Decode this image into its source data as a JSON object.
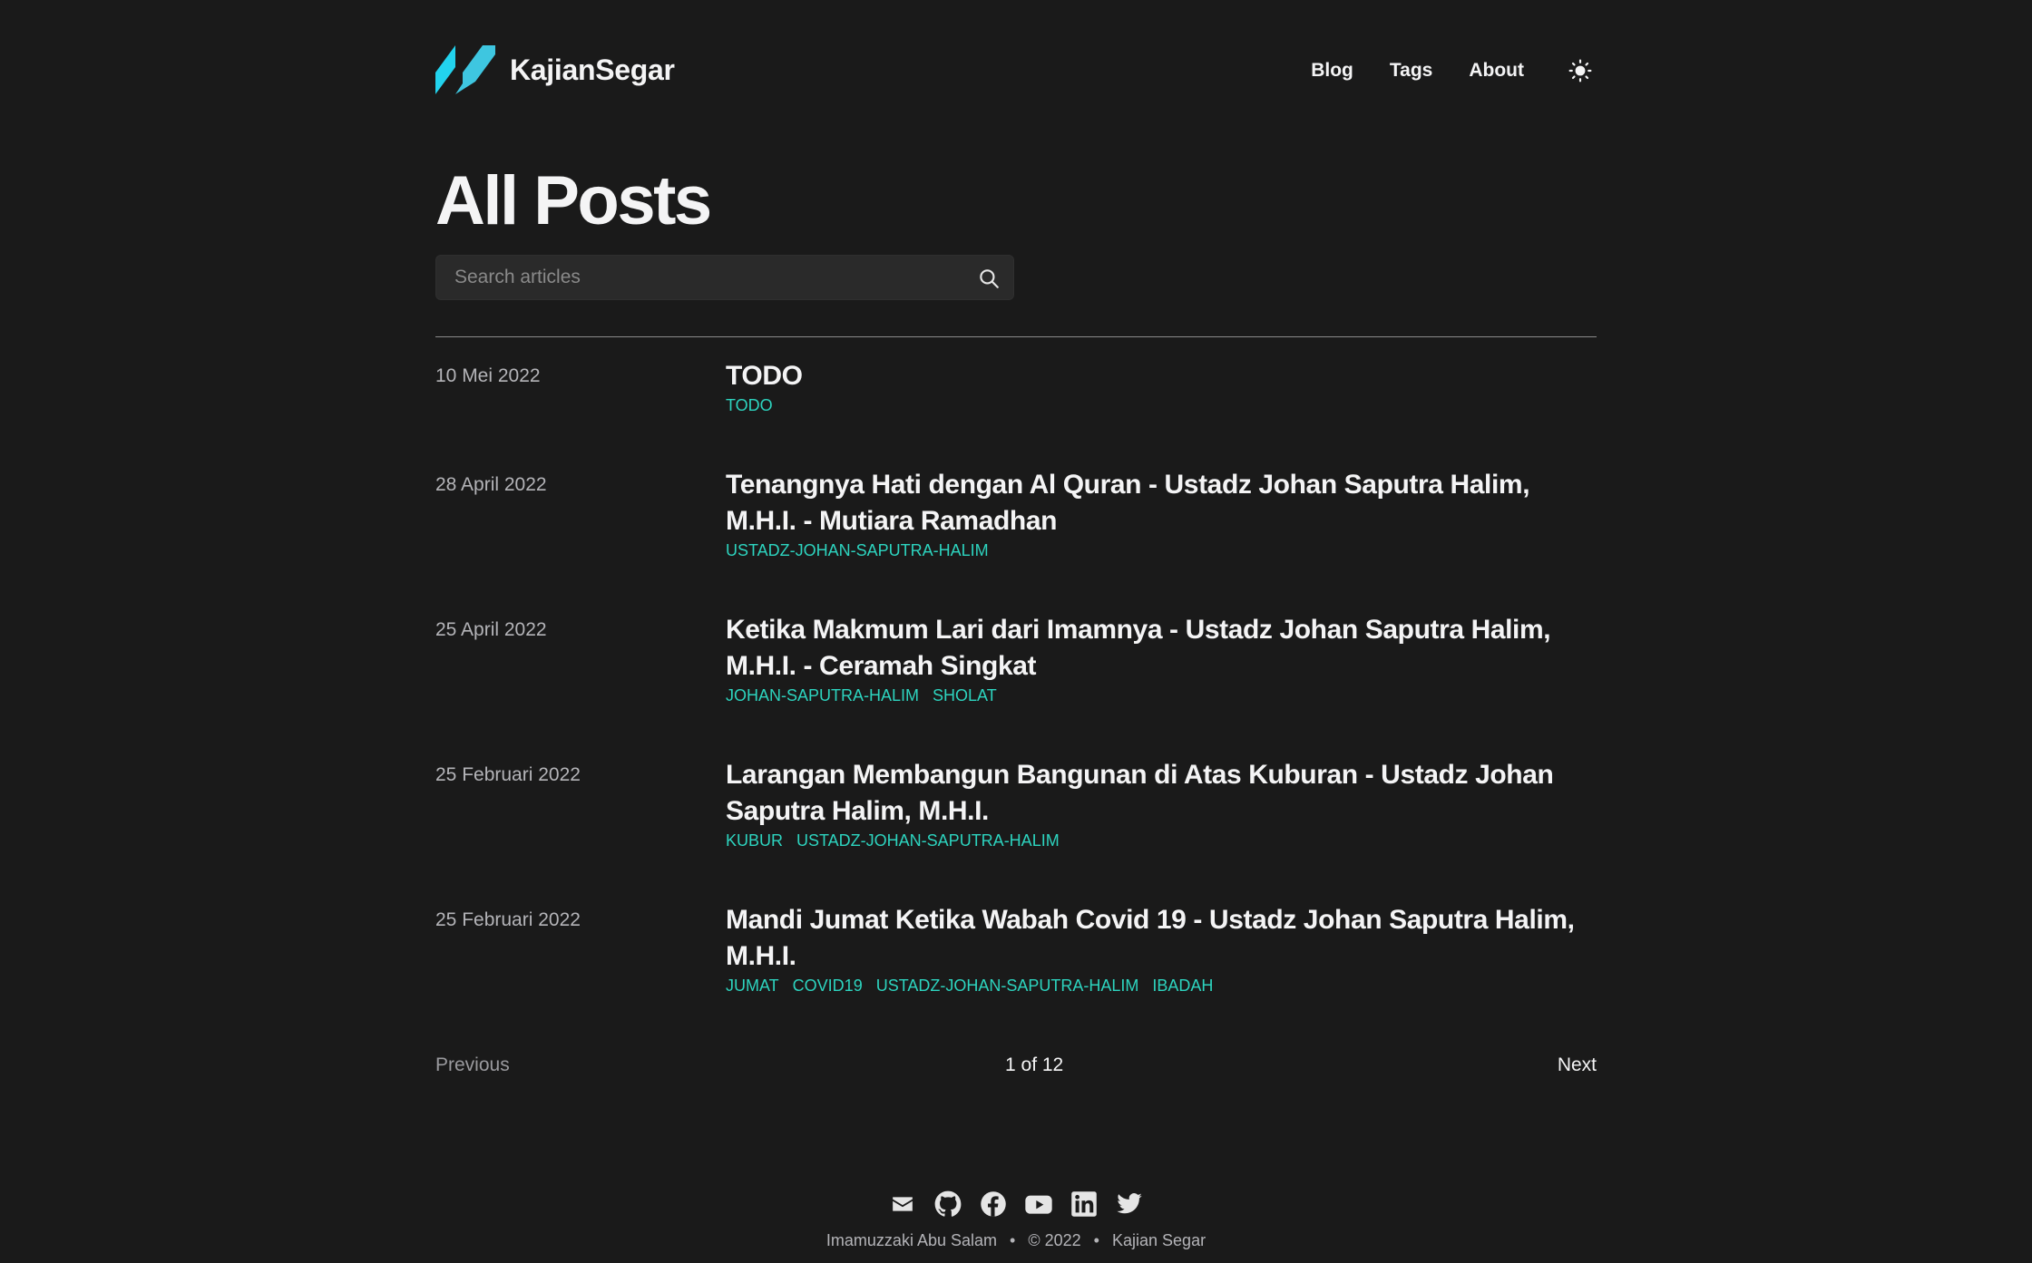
{
  "site": {
    "brand": "KajianSegar",
    "accent_color": "#2dd4bf",
    "logo_colors": [
      "#22d3ee",
      "#3ec6e0"
    ]
  },
  "nav": {
    "items": [
      {
        "label": "Blog"
      },
      {
        "label": "Tags"
      },
      {
        "label": "About"
      }
    ],
    "theme_toggle_icon": "sun-icon"
  },
  "main": {
    "title": "All Posts",
    "search": {
      "placeholder": "Search articles",
      "value": "",
      "icon": "search-icon"
    }
  },
  "posts": [
    {
      "date": "10 Mei 2022",
      "title": "TODO",
      "tags": [
        "TODO"
      ]
    },
    {
      "date": "28 April 2022",
      "title": "Tenangnya Hati dengan Al Quran - Ustadz Johan Saputra Halim, M.H.I. - Mutiara Ramadhan",
      "tags": [
        "USTADZ-JOHAN-SAPUTRA-HALIM"
      ]
    },
    {
      "date": "25 April 2022",
      "title": "Ketika Makmum Lari dari Imamnya - Ustadz Johan Saputra Halim, M.H.I. - Ceramah Singkat",
      "tags": [
        "JOHAN-SAPUTRA-HALIM",
        "SHOLAT"
      ]
    },
    {
      "date": "25 Februari 2022",
      "title": "Larangan Membangun Bangunan di Atas Kuburan - Ustadz Johan Saputra Halim, M.H.I.",
      "tags": [
        "KUBUR",
        "USTADZ-JOHAN-SAPUTRA-HALIM"
      ]
    },
    {
      "date": "25 Februari 2022",
      "title": "Mandi Jumat Ketika Wabah Covid 19 - Ustadz Johan Saputra Halim, M.H.I.",
      "tags": [
        "JUMAT",
        "COVID19",
        "USTADZ-JOHAN-SAPUTRA-HALIM",
        "IBADAH"
      ]
    }
  ],
  "pagination": {
    "previous": "Previous",
    "indicator": "1 of 12",
    "next": "Next"
  },
  "footer": {
    "social_icons": [
      "mail-icon",
      "github-icon",
      "facebook-icon",
      "youtube-icon",
      "linkedin-icon",
      "twitter-icon"
    ],
    "author": "Imamuzzaki Abu Salam",
    "separator": "•",
    "copyright": "© 2022",
    "site_name": "Kajian Segar"
  }
}
